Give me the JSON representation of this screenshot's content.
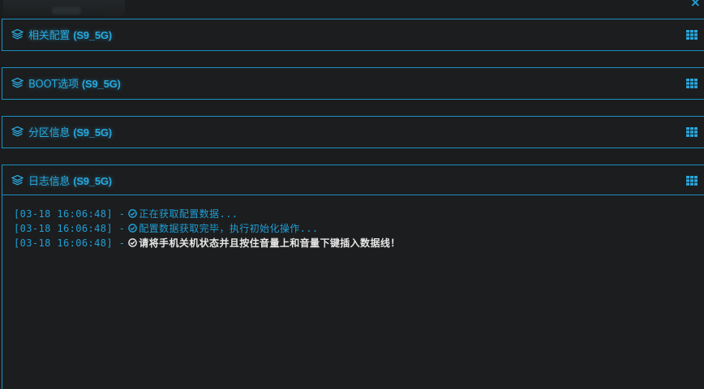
{
  "colors": {
    "accent": "#1fa3d9",
    "background": "#1b1c1d",
    "warning_text": "#e6e6e6"
  },
  "window": {
    "close_glyph": "×"
  },
  "panels": [
    {
      "title": "相关配置",
      "device": "(S9_5G)",
      "icon": "layers-icon",
      "action_icon": "grid-icon"
    },
    {
      "title": "BOOT选项",
      "device": "(S9_5G)",
      "icon": "layers-icon",
      "action_icon": "grid-icon"
    },
    {
      "title": "分区信息",
      "device": "(S9_5G)",
      "icon": "layers-icon",
      "action_icon": "grid-icon"
    },
    {
      "title": "日志信息",
      "device": "(S9_5G)",
      "icon": "layers-icon",
      "action_icon": "grid-icon"
    }
  ],
  "log": {
    "entries": [
      {
        "timestamp": "[03-18 16:06:48]",
        "separator": "-",
        "icon": "check-circle-icon",
        "message": "正在获取配置数据...",
        "style": "info"
      },
      {
        "timestamp": "[03-18 16:06:48]",
        "separator": "-",
        "icon": "check-circle-icon",
        "message": "配置数据获取完毕，执行初始化操作...",
        "style": "info"
      },
      {
        "timestamp": "[03-18 16:06:48]",
        "separator": "-",
        "icon": "check-circle-icon",
        "message": "请将手机关机状态并且按住音量上和音量下键插入数据线！",
        "style": "warn"
      }
    ]
  }
}
